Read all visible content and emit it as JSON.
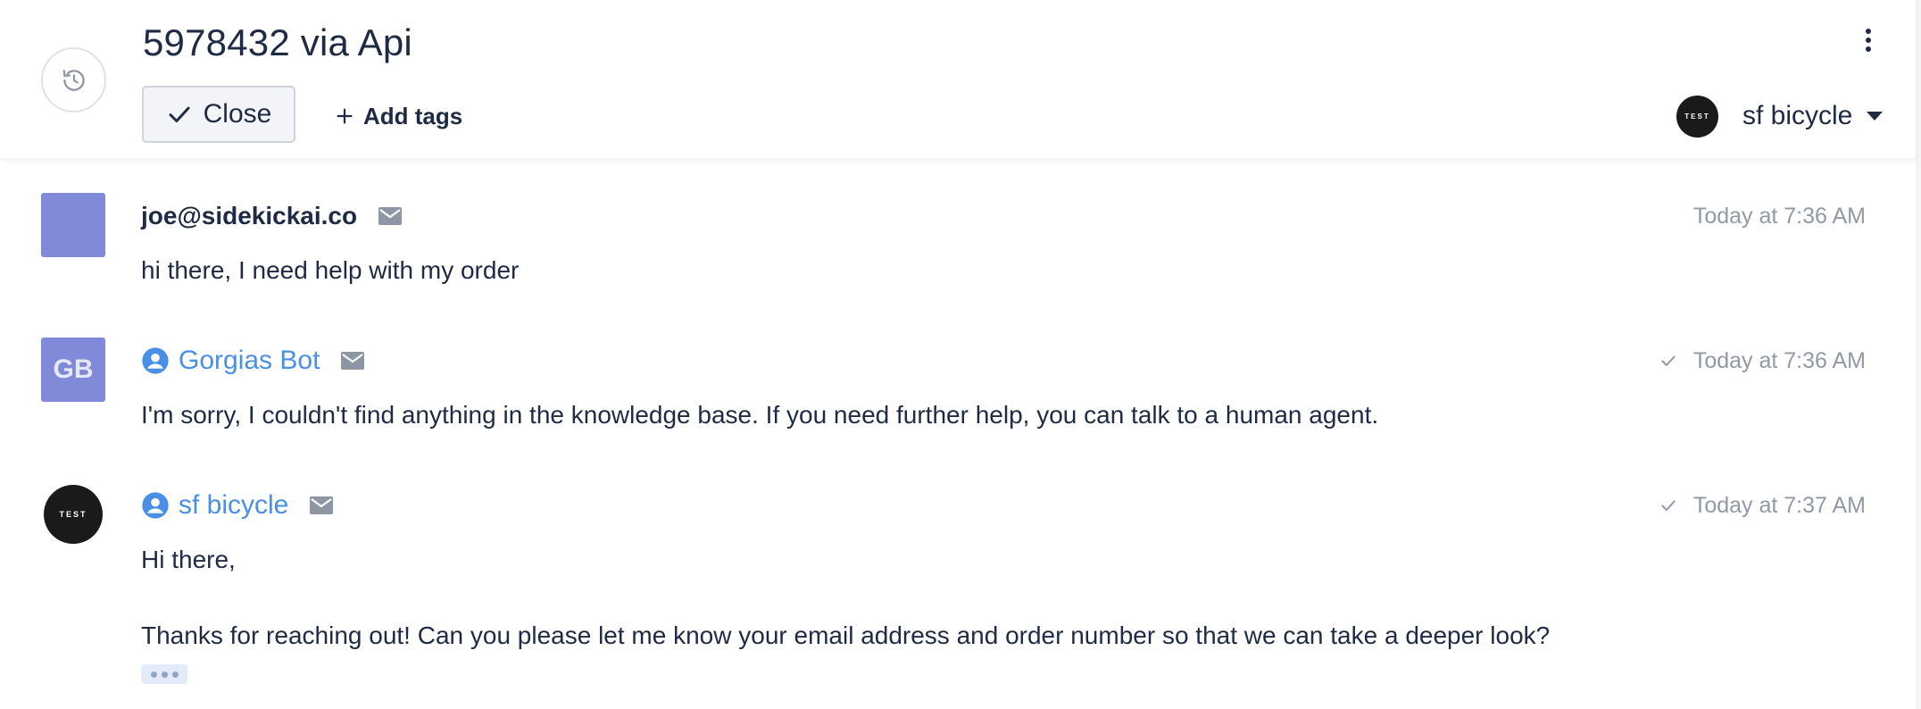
{
  "header": {
    "title": "5978432 via Api",
    "close_label": "Close",
    "add_tags_label": "Add tags",
    "store": {
      "logo_text": "TEST",
      "name": "sf bicycle"
    }
  },
  "messages": [
    {
      "sender": "joe@sidekickai.co",
      "avatar_text": "",
      "timestamp": "Today at 7:36 AM",
      "body": [
        "hi there, I need help with my order"
      ]
    },
    {
      "sender": "Gorgias Bot",
      "avatar_text": "GB",
      "timestamp": "Today at 7:36 AM",
      "body": [
        "I'm sorry, I couldn't find anything in the knowledge base. If you need further help, you can talk to a human agent."
      ]
    },
    {
      "sender": "sf bicycle",
      "avatar_text": "TEST",
      "timestamp": "Today at 7:37 AM",
      "body": [
        "Hi there,",
        "Thanks for reaching out! Can you please let me know your email address and order number so that we can take a deeper look?"
      ]
    }
  ],
  "icons": {
    "history": "history-icon",
    "close_check": "check-icon",
    "add": "plus-icon",
    "menu": "kebab-menu-icon",
    "channel": "mail-icon",
    "agent": "user-circle-icon",
    "sent": "check-icon"
  },
  "colors": {
    "text": "#1f2a44",
    "link": "#4a8fe6",
    "muted": "#9198a6",
    "avatar_bg": "#8189d9"
  }
}
